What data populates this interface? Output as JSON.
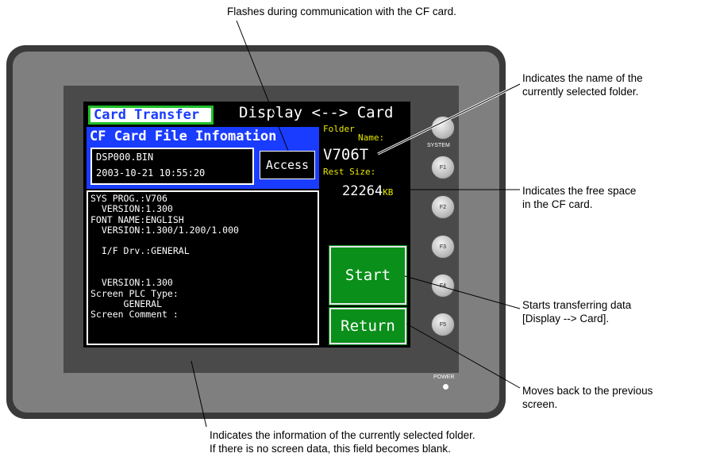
{
  "annotations": {
    "top": "Flashes during communication with the CF card.",
    "folder_name": "Indicates the name of the\ncurrently selected folder.",
    "free_space": "Indicates the free space\nin the CF card.",
    "start": "Starts transferring data\n[Display --> Card].",
    "return": "Moves back to the previous\nscreen.",
    "info": "Indicates the information of the currently selected folder.\nIf there is no screen data, this field becomes blank."
  },
  "screen": {
    "title_tab": "Card Transfer",
    "mode": "Display <--> Card",
    "info_header": "CF Card File Infomation",
    "file_name": "DSP000.BIN",
    "file_date": "2003-10-21 10:55:20",
    "access_label": "Access",
    "folder_label_1": "Folder",
    "folder_label_2": "Name:",
    "folder_name": "V706T",
    "rest_size_label": "Rest Size:",
    "rest_size_value": "22264",
    "rest_size_unit": "KB",
    "info_lines": [
      "SYS PROG.:V706",
      "  VERSION:1.300",
      "FONT NAME:ENGLISH",
      "  VERSION:1.300/1.200/1.000",
      "",
      "  I/F Drv.:GENERAL",
      "",
      "",
      "  VERSION:1.300",
      "Screen PLC Type:",
      "      GENERAL",
      "Screen Comment :"
    ],
    "start_label": "Start",
    "return_label": "Return"
  },
  "device": {
    "system_label": "SYSTEM",
    "keys": [
      "F1",
      "F2",
      "F3",
      "F4",
      "F5"
    ],
    "power_label": "POWER"
  },
  "colors": {
    "screen_bg": "#000000",
    "header_blue": "#1a3cff",
    "button_green": "#0a8f1a",
    "tab_border_green": "#1fbf2a",
    "label_yellow": "#e8e800"
  }
}
